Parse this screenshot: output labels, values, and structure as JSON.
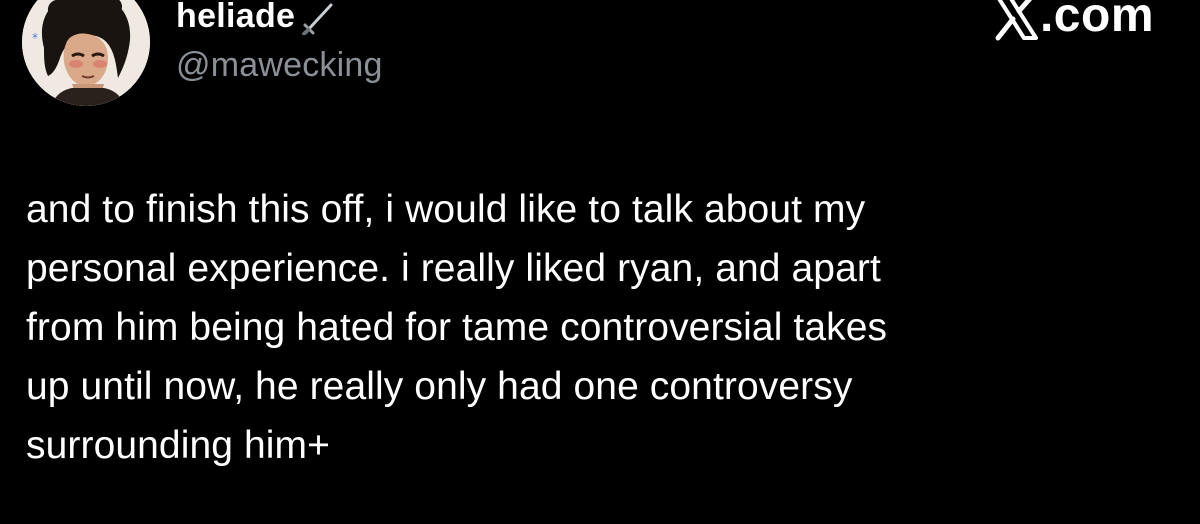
{
  "author": {
    "display_name": "heliade",
    "handle": "@mawecking",
    "name_icon": "sword-icon",
    "avatar": "avatar"
  },
  "brand": {
    "logo_icon": "x-logo-icon",
    "text": ".com"
  },
  "tweet": {
    "lines": [
      "and to finish this off, i would like to talk about my",
      "personal experience. i really liked ryan, and apart",
      "from him being hated for tame controversial takes",
      "up until now, he really only had one controversy",
      "surrounding him+"
    ]
  },
  "colors": {
    "background": "#000000",
    "text": "#ffffff",
    "handle": "#8b9096"
  }
}
